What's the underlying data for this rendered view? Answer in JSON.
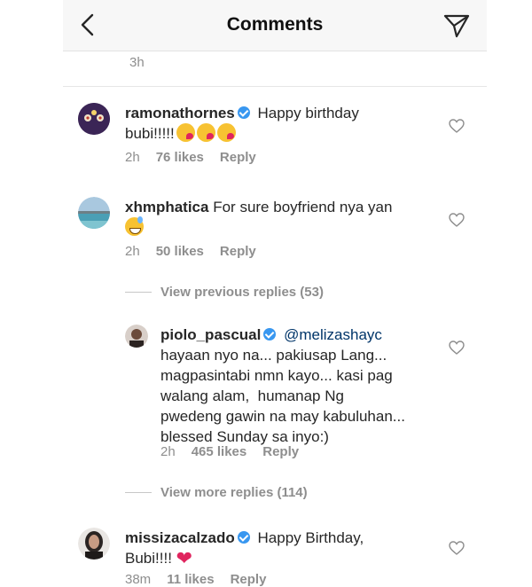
{
  "header": {
    "title": "Comments"
  },
  "top_timestamp": "3h",
  "comments": [
    {
      "username": "ramonathornes",
      "verified": true,
      "line1": "Happy birthday",
      "line2": "bubi!!!!!",
      "time": "2h",
      "likes": "76 likes",
      "reply": "Reply"
    },
    {
      "username": "xhmphatica",
      "verified": false,
      "line1": "For sure boyfriend nya yan",
      "time": "2h",
      "likes": "50 likes",
      "reply": "Reply"
    },
    {
      "username": "missizacalzado",
      "verified": true,
      "line1": "Happy Birthday,",
      "line2": "Bubi!!!!",
      "time": "38m",
      "likes": "11 likes",
      "reply": "Reply"
    }
  ],
  "view_previous_replies": "View previous replies (53)",
  "reply": {
    "username": "piolo_pascual",
    "verified": true,
    "mention": "@melizashayc",
    "lines": [
      "hayaan nyo na... pakiusap Lang...",
      "magpasintabi nmn kayo... kasi pag",
      "walang alam,  humanap Ng",
      "pwedeng gawin na may kabuluhan...",
      "blessed Sunday sa inyo:)"
    ],
    "time": "2h",
    "likes": "465 likes",
    "reply": "Reply"
  },
  "view_more_replies": "View more replies (114)",
  "icons": [
    "back-arrow-icon",
    "send-icon",
    "heart-outline-icon",
    "verified-badge-icon",
    "kissing-face-emoji",
    "grinning-sweat-emoji",
    "red-heart-emoji"
  ]
}
